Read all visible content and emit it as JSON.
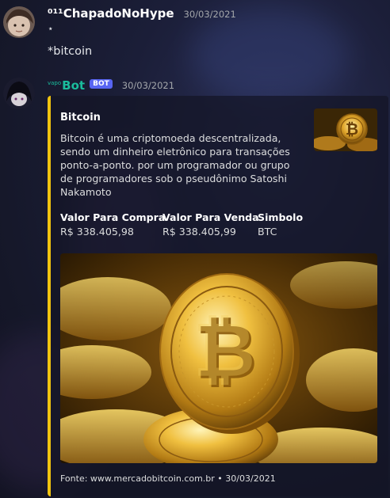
{
  "messages": [
    {
      "username": "⁰¹¹ChapadoNoHype",
      "timestamp": "30/03/2021",
      "lines": [
        "⋆",
        "*bitcoin"
      ]
    }
  ],
  "bot_message": {
    "name_prefix": "vapo",
    "username": "Bot",
    "badge": "BOT",
    "timestamp": "30/03/2021",
    "embed": {
      "accent_color": "#f1c40f",
      "title": "Bitcoin",
      "description": "Bitcoin é uma criptomoeda descentralizada, sendo um dinheiro eletrônico para transações ponto-a-ponto. por um programador ou grupo de programadores sob o pseudônimo Satoshi Nakamoto",
      "fields": [
        {
          "name": "Valor Para Compra",
          "value": "R$ 338.405,98"
        },
        {
          "name": "Valor Para Venda",
          "value": "R$ 338.405,99"
        },
        {
          "name": "Simbolo",
          "value": "BTC"
        }
      ],
      "thumbnail_icon": "bitcoin-coins-thumbnail",
      "image_icon": "bitcoin-coins-image",
      "footer": "Fonte: www.mercadobitcoin.com.br • 30/03/2021"
    }
  }
}
